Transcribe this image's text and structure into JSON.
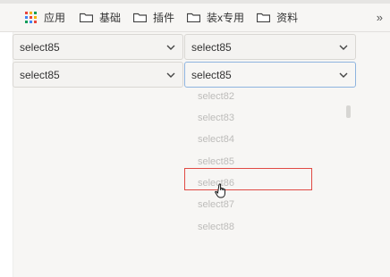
{
  "bookmarks_bar": {
    "apps_label": "应用",
    "items": [
      {
        "label": "基础"
      },
      {
        "label": "插件"
      },
      {
        "label": "装x专用"
      },
      {
        "label": "资料"
      }
    ],
    "more_label": "»"
  },
  "selects": {
    "row1_left": "select85",
    "row1_right": "select85",
    "row2_left": "select85",
    "row2_right": "select85"
  },
  "dropdown": {
    "options": [
      "select82",
      "select83",
      "select84",
      "select85",
      "select86",
      "select87",
      "select88"
    ],
    "hovered_option": "select86"
  },
  "colors": {
    "highlight_border": "#e04a43",
    "active_select_border": "#8eb4df",
    "option_text": "#bdbcba"
  }
}
